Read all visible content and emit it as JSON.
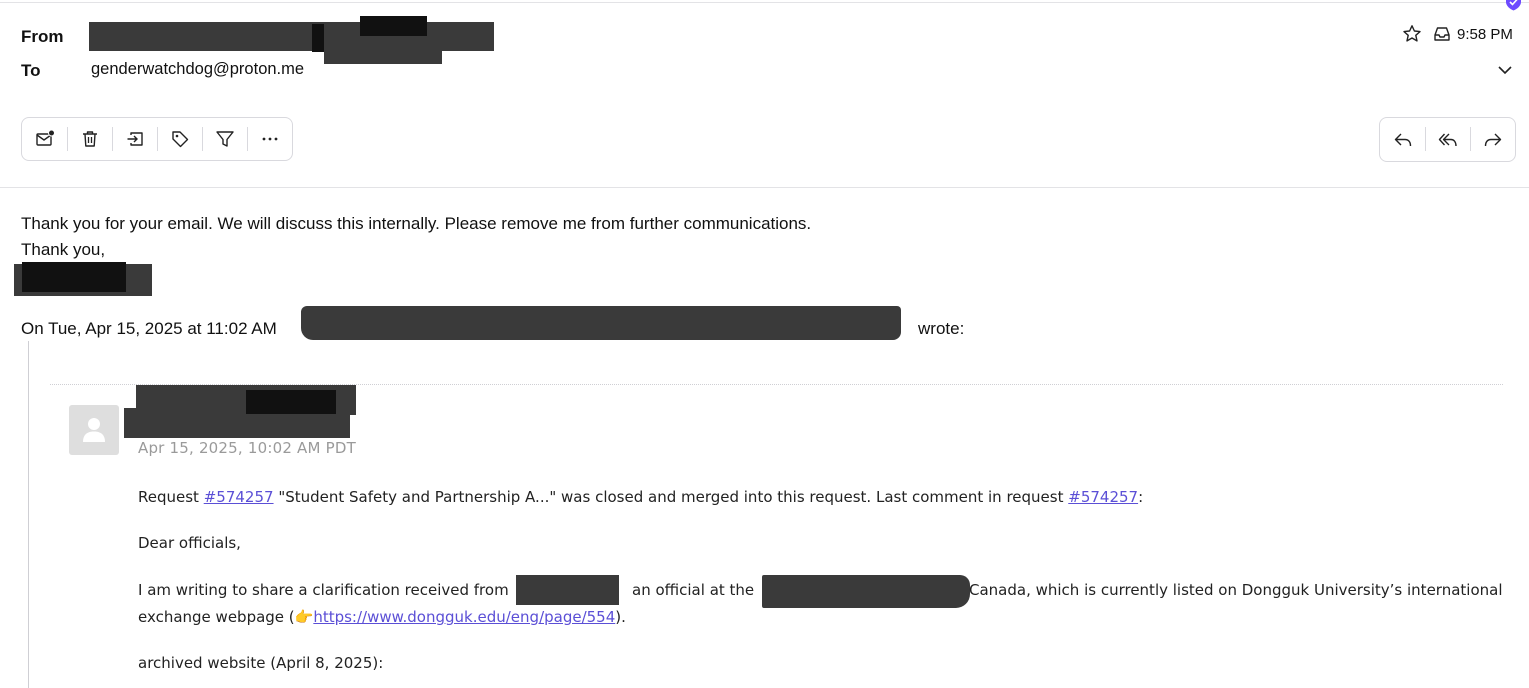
{
  "header": {
    "from_label": "From",
    "to_label": "To",
    "to_address": "genderwatchdog@proton.me",
    "time": "9:58 PM"
  },
  "icons": {
    "security": "shield-check-icon",
    "star": "star-icon",
    "location": "inbox-icon",
    "expand": "chevron-down-icon"
  },
  "toolbar": {
    "actions": [
      "mark-unread",
      "delete",
      "move",
      "label",
      "filter",
      "more"
    ],
    "reply_actions": [
      "reply",
      "reply-all",
      "forward"
    ]
  },
  "message": {
    "line1": "Thank you for your email. We will discuss this internally. Please remove me from further communications.",
    "line2": "Thank you,",
    "quote_intro": "On Tue, Apr 15, 2025 at 11:02 AM",
    "quote_wrote": "wrote:"
  },
  "quoted": {
    "date": "Apr 15, 2025, 10:02 AM PDT",
    "req_prefix": "Request ",
    "req_link": "#574257",
    "req_middle": " \"Student Safety and Partnership A...\" was closed and merged into this request. Last comment in request ",
    "req_link2": "#574257",
    "req_suffix": ":",
    "salutation": "Dear officials,",
    "p1_a": "I am writing to share a clarification received from",
    "p1_b": "an official at the",
    "p1_c": "Canada, which is currently listed on Dongguk University’s international",
    "p1_d": "exchange webpage (👉",
    "p1_link": "https://www.dongguk.edu/eng/page/554",
    "p1_e": ").",
    "archived": "archived website (April 8, 2025):"
  },
  "colors": {
    "link": "#5b4fd6",
    "brand": "#6d4aff",
    "redaction": "#3a3a3a"
  }
}
